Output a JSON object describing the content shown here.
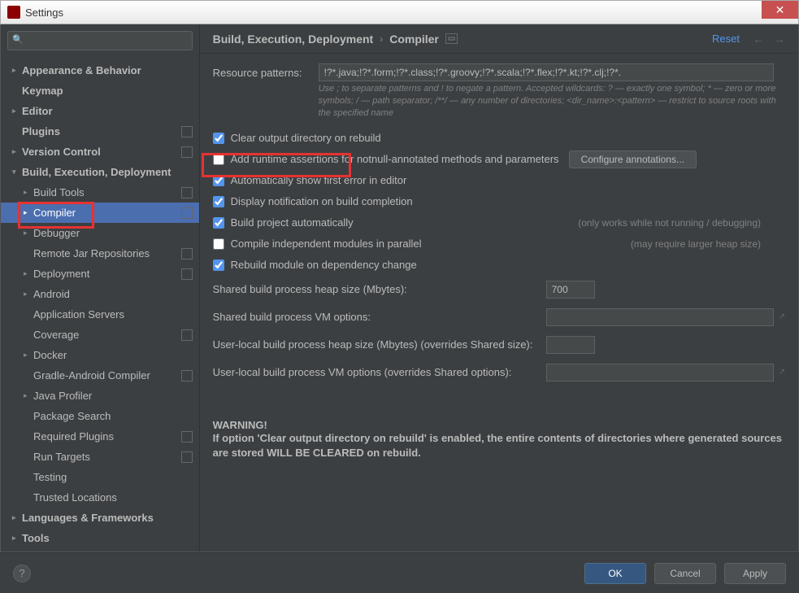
{
  "window": {
    "title": "Settings"
  },
  "sidebar": {
    "search_placeholder": "",
    "items": [
      {
        "label": "Appearance & Behavior",
        "level": 0,
        "bold": true,
        "arrow": ">"
      },
      {
        "label": "Keymap",
        "level": 0,
        "bold": true,
        "arrow": ""
      },
      {
        "label": "Editor",
        "level": 0,
        "bold": true,
        "arrow": ">"
      },
      {
        "label": "Plugins",
        "level": 0,
        "bold": true,
        "arrow": "",
        "badge": true
      },
      {
        "label": "Version Control",
        "level": 0,
        "bold": true,
        "arrow": ">",
        "badge": true
      },
      {
        "label": "Build, Execution, Deployment",
        "level": 0,
        "bold": true,
        "arrow": "v"
      },
      {
        "label": "Build Tools",
        "level": 1,
        "arrow": ">",
        "badge": true
      },
      {
        "label": "Compiler",
        "level": 1,
        "arrow": ">",
        "badge": true,
        "selected": true
      },
      {
        "label": "Debugger",
        "level": 1,
        "arrow": ">"
      },
      {
        "label": "Remote Jar Repositories",
        "level": 1,
        "arrow": "",
        "badge": true
      },
      {
        "label": "Deployment",
        "level": 1,
        "arrow": ">",
        "badge": true
      },
      {
        "label": "Android",
        "level": 1,
        "arrow": ">"
      },
      {
        "label": "Application Servers",
        "level": 1,
        "arrow": ""
      },
      {
        "label": "Coverage",
        "level": 1,
        "arrow": "",
        "badge": true
      },
      {
        "label": "Docker",
        "level": 1,
        "arrow": ">"
      },
      {
        "label": "Gradle-Android Compiler",
        "level": 1,
        "arrow": "",
        "badge": true
      },
      {
        "label": "Java Profiler",
        "level": 1,
        "arrow": ">"
      },
      {
        "label": "Package Search",
        "level": 1,
        "arrow": ""
      },
      {
        "label": "Required Plugins",
        "level": 1,
        "arrow": "",
        "badge": true
      },
      {
        "label": "Run Targets",
        "level": 1,
        "arrow": "",
        "badge": true
      },
      {
        "label": "Testing",
        "level": 1,
        "arrow": ""
      },
      {
        "label": "Trusted Locations",
        "level": 1,
        "arrow": ""
      },
      {
        "label": "Languages & Frameworks",
        "level": 0,
        "bold": true,
        "arrow": ">"
      },
      {
        "label": "Tools",
        "level": 0,
        "bold": true,
        "arrow": ">"
      }
    ]
  },
  "header": {
    "crumb1": "Build, Execution, Deployment",
    "crumb2": "Compiler",
    "reset": "Reset"
  },
  "content": {
    "resource_patterns_label": "Resource patterns:",
    "resource_patterns_value": "!?*.java;!?*.form;!?*.class;!?*.groovy;!?*.scala;!?*.flex;!?*.kt;!?*.clj;!?*.",
    "resource_help": "Use ; to separate patterns and ! to negate a pattern. Accepted wildcards: ? — exactly one symbol; * — zero or more symbols; / — path separator; /**/ — any number of directories; <dir_name>:<pattern> — restrict to source roots with the specified name",
    "chk_clear": "Clear output directory on rebuild",
    "chk_runtime": "Add runtime assertions for notnull-annotated methods and parameters",
    "btn_configure": "Configure annotations...",
    "chk_autoerr": "Automatically show first error in editor",
    "chk_notify": "Display notification on build completion",
    "chk_build_auto": "Build project automatically",
    "hint_build_auto": "(only works while not running / debugging)",
    "chk_parallel": "Compile independent modules in parallel",
    "hint_parallel": "(may require larger heap size)",
    "chk_rebuild": "Rebuild module on dependency change",
    "f_heap": "Shared build process heap size (Mbytes):",
    "f_heap_val": "700",
    "f_vm": "Shared build process VM options:",
    "f_vm_val": "",
    "f_uheap": "User-local build process heap size (Mbytes) (overrides Shared size):",
    "f_uheap_val": "",
    "f_uvm": "User-local build process VM options (overrides Shared options):",
    "f_uvm_val": "",
    "warn_title": "WARNING!",
    "warn_text": "If option 'Clear output directory on rebuild' is enabled, the entire contents of directories where generated sources are stored WILL BE CLEARED on rebuild."
  },
  "footer": {
    "ok": "OK",
    "cancel": "Cancel",
    "apply": "Apply"
  }
}
